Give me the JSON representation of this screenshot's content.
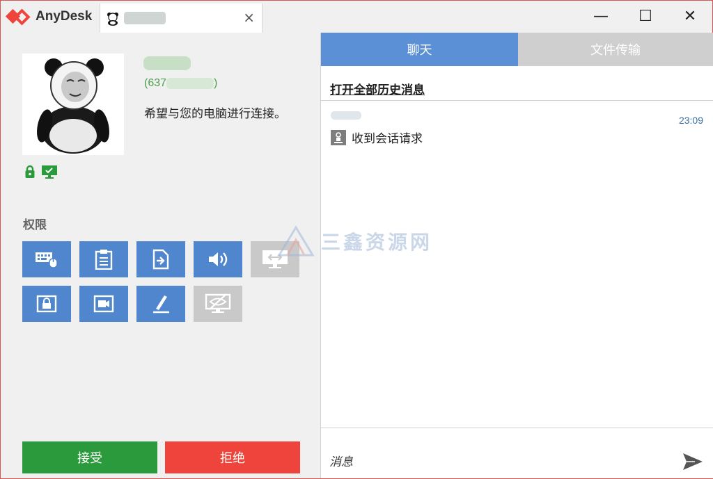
{
  "app": {
    "name": "AnyDesk"
  },
  "session_tab": {
    "label": "",
    "close": "×"
  },
  "window_controls": {
    "minimize": "—",
    "maximize": "☐",
    "close": "✕"
  },
  "request": {
    "user_id_prefix": "(637",
    "user_id_suffix": ")",
    "message": "希望与您的电脑进行连接。"
  },
  "permissions": {
    "label": "权限",
    "buttons": [
      {
        "name": "keyboard-mouse",
        "enabled": true
      },
      {
        "name": "clipboard",
        "enabled": true
      },
      {
        "name": "file-manager",
        "enabled": true
      },
      {
        "name": "sound",
        "enabled": true
      },
      {
        "name": "switch-sides",
        "enabled": false
      },
      {
        "name": "lock-screen",
        "enabled": true
      },
      {
        "name": "record-session",
        "enabled": true
      },
      {
        "name": "draw",
        "enabled": true
      },
      {
        "name": "privacy-mode",
        "enabled": false
      }
    ]
  },
  "actions": {
    "accept": "接受",
    "reject": "拒绝"
  },
  "tabs": {
    "chat": "聊天",
    "files": "文件传输"
  },
  "chat": {
    "history_link": "打开全部历史消息",
    "messages": [
      {
        "time": "23:09",
        "text": "收到会话请求"
      }
    ],
    "input_placeholder": "消息"
  },
  "watermark": {
    "text": "三鑫资源网"
  },
  "colors": {
    "accent_blue": "#4f86cd",
    "accept_green": "#2b9a3c",
    "reject_red": "#ef443b",
    "id_green": "#4aa04a"
  }
}
